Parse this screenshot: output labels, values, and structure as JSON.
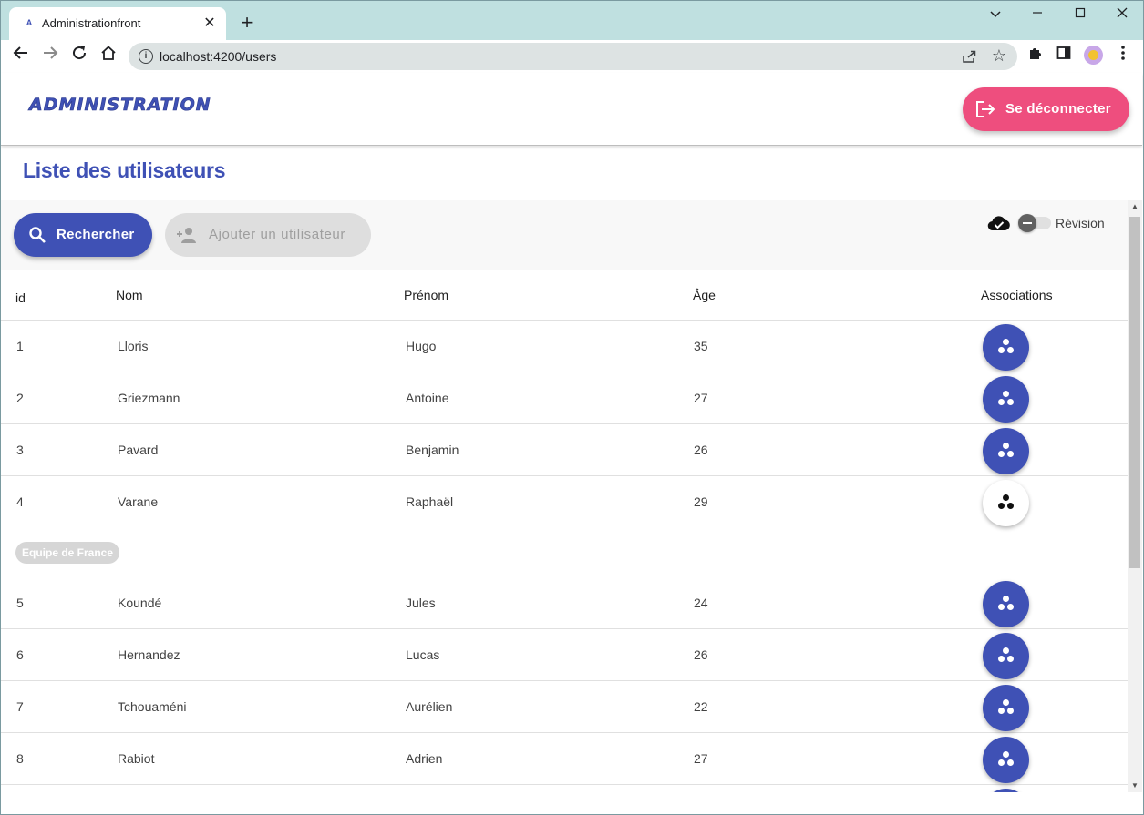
{
  "browser": {
    "tab_title": "Administrationfront",
    "url": "localhost:4200/users",
    "favicon_letter": "A"
  },
  "app": {
    "brand": "ADMINISTRATION",
    "logout_label": "Se déconnecter",
    "page_title": "Liste des utilisateurs",
    "search_label": "Rechercher",
    "add_user_label": "Ajouter un utilisateur",
    "toggle_label": "Révision"
  },
  "table": {
    "headers": {
      "id": "id",
      "nom": "Nom",
      "prenom": "Prénom",
      "age": "Âge",
      "associations": "Associations"
    },
    "rows": [
      {
        "id": "1",
        "nom": "Lloris",
        "prenom": "Hugo",
        "age": "35"
      },
      {
        "id": "2",
        "nom": "Griezmann",
        "prenom": "Antoine",
        "age": "27"
      },
      {
        "id": "3",
        "nom": "Pavard",
        "prenom": "Benjamin",
        "age": "26"
      },
      {
        "id": "4",
        "nom": "Varane",
        "prenom": "Raphaël",
        "age": "29"
      },
      {
        "id": "5",
        "nom": "Koundé",
        "prenom": "Jules",
        "age": "24"
      },
      {
        "id": "6",
        "nom": "Hernandez",
        "prenom": "Lucas",
        "age": "26"
      },
      {
        "id": "7",
        "nom": "Tchouaméni",
        "prenom": "Aurélien",
        "age": "22"
      },
      {
        "id": "8",
        "nom": "Rabiot",
        "prenom": "Adrien",
        "age": "27"
      }
    ],
    "expanded_association": "Equipe de France"
  },
  "colors": {
    "primary": "#3f51b5",
    "accent": "#ee4e7e"
  },
  "icons": {
    "logout": "logout-icon",
    "search": "search-icon",
    "add_user": "person-add-icon",
    "cloud": "cloud-done-icon",
    "association": "workspaces-icon"
  }
}
